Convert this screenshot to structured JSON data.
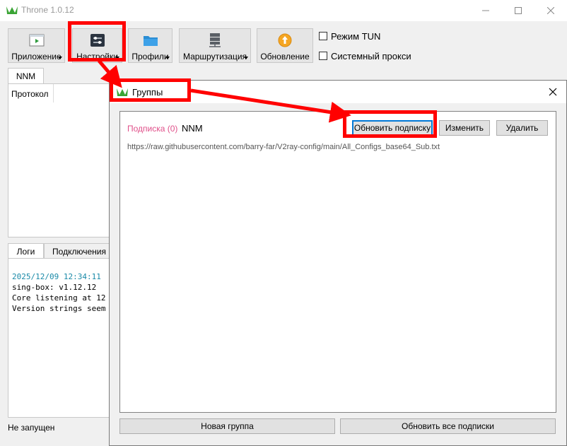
{
  "window": {
    "title": "Throne 1.0.12"
  },
  "toolbar": {
    "buttons": [
      {
        "label": "Приложение"
      },
      {
        "label": "Настройки"
      },
      {
        "label": "Профили"
      },
      {
        "label": "Маршрутизация"
      },
      {
        "label": "Обновление"
      }
    ],
    "tun_mode": "Режим TUN",
    "system_proxy": "Системный прокси"
  },
  "main": {
    "group_tab": "NNM",
    "column_header": "Протокол",
    "log_tabs": [
      "Логи",
      "Подключения"
    ],
    "log_lines": [
      "2025/12/09 12:34:11",
      "sing-box: v1.12.12",
      "Core listening at 12",
      "Version strings seem"
    ],
    "status": "Не запущен"
  },
  "dialog": {
    "title": "Группы",
    "group": {
      "type_label": "Подписка (0)",
      "name": "NNM",
      "url": "https://raw.githubusercontent.com/barry-far/V2ray-config/main/All_Configs_base64_Sub.txt",
      "update_button": "Обновить подписку",
      "edit_button": "Изменить",
      "delete_button": "Удалить"
    },
    "new_group_button": "Новая группа",
    "update_all_button": "Обновить все подписки"
  },
  "colors": {
    "subscription_label": "#e0508a",
    "log_timestamp": "#1a8aa8",
    "annotation": "#ff0000",
    "focus": "#0078d7"
  }
}
